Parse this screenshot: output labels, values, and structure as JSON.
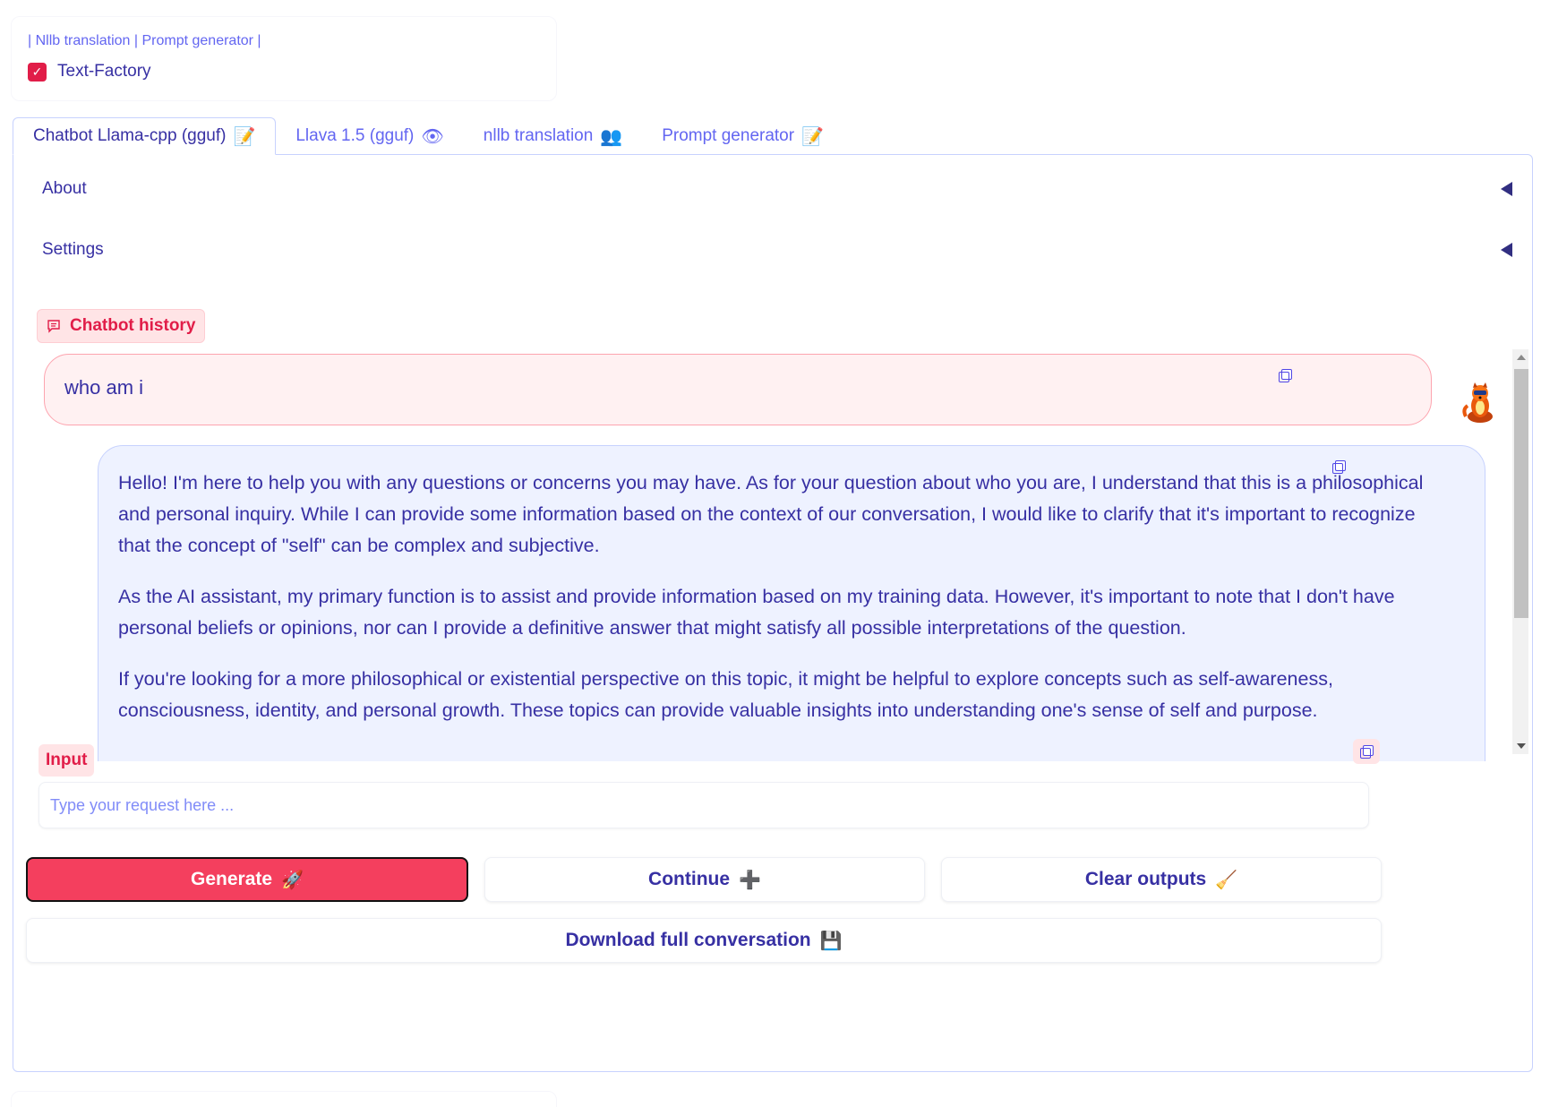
{
  "top": {
    "links": "| Nllb translation | Prompt generator |",
    "checkbox_label": "Text-Factory",
    "checkbox_checked": true
  },
  "tabs": [
    {
      "label": "Chatbot Llama-cpp (gguf)",
      "icon": "memo-icon",
      "active": true
    },
    {
      "label": "Llava 1.5 (gguf)",
      "icon": "eye-icon",
      "active": false
    },
    {
      "label": "nllb translation",
      "icon": "people-icon",
      "active": false
    },
    {
      "label": "Prompt generator",
      "icon": "memo-icon",
      "active": false
    }
  ],
  "accordions": [
    {
      "label": "About",
      "expanded": false
    },
    {
      "label": "Settings",
      "expanded": false
    }
  ],
  "chatbot": {
    "label": "Chatbot history",
    "user_message": "who am i",
    "bot_paragraphs": [
      "Hello! I'm here to help you with any questions or concerns you may have. As for your question about who you are, I understand that this is a philosophical and personal inquiry. While I can provide some information based on the context of our conversation, I would like to clarify that it's important to recognize that the concept of \"self\" can be complex and subjective.",
      "As the AI assistant, my primary function is to assist and provide information based on my training data. However, it's important to note that I don't have personal beliefs or opinions, nor can I provide a definitive answer that might satisfy all possible interpretations of the question.",
      "If you're looking for a more philosophical or existential perspective on this topic, it might be helpful to explore concepts such as self-awareness, consciousness, identity, and personal growth. These topics can provide valuable insights into understanding one's sense of self and purpose."
    ]
  },
  "input": {
    "label": "Input",
    "placeholder": "Type your request here ...",
    "value": ""
  },
  "buttons": {
    "generate": "Generate",
    "continue": "Continue",
    "clear": "Clear outputs",
    "download": "Download full conversation"
  },
  "colors": {
    "accent": "#f43f5e",
    "text": "#3730a3",
    "link": "#6366f1",
    "bot_bubble": "#eef2ff",
    "user_bubble": "#fff1f2"
  }
}
